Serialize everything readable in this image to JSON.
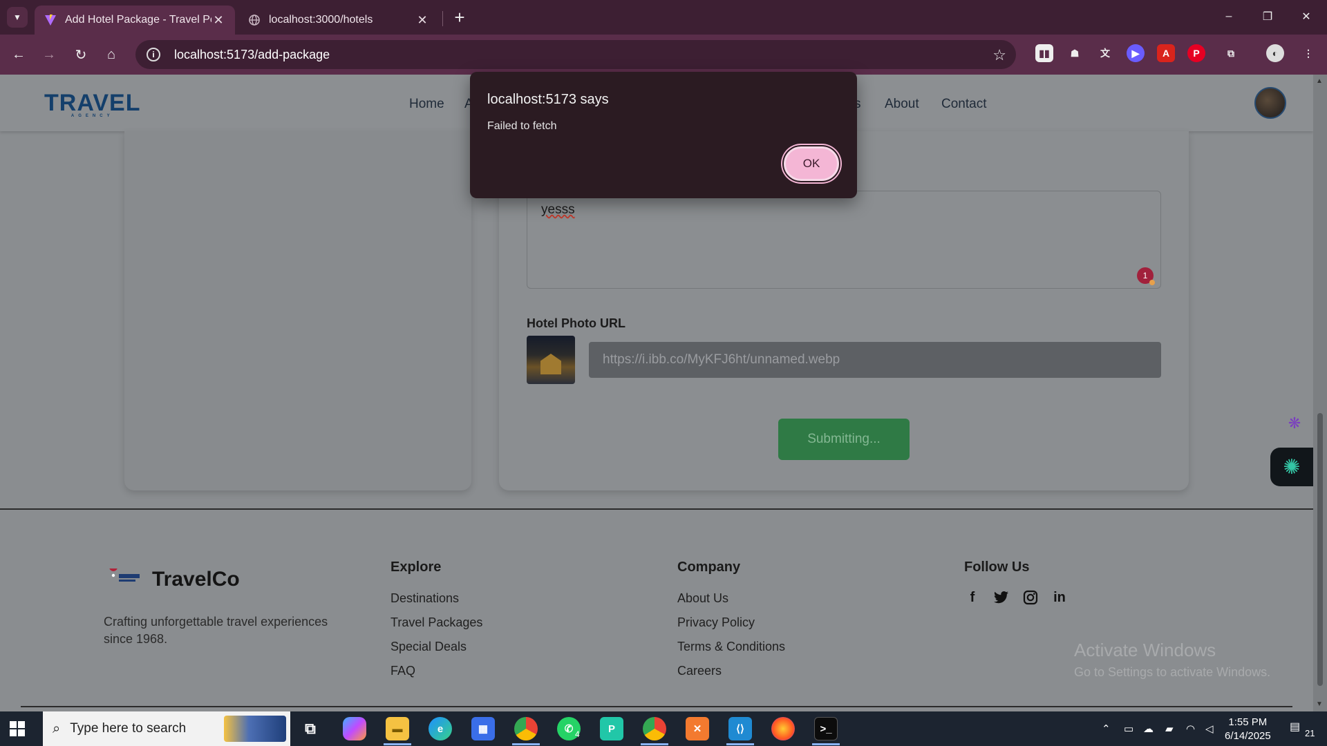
{
  "browser": {
    "tabs": [
      {
        "title": "Add Hotel Package - Travel Port",
        "active": true
      },
      {
        "title": "localhost:3000/hotels",
        "active": false
      }
    ],
    "url": "localhost:5173/add-package",
    "window_controls": {
      "minimize": "–",
      "restore": "❐",
      "close": "✕"
    }
  },
  "header": {
    "logo_main": "TRAVEL",
    "logo_sub": "AGENCY",
    "nav": [
      "Home",
      "A",
      "s",
      "About",
      "Contact"
    ]
  },
  "form": {
    "textarea_value": "yesss",
    "badge_count": "1",
    "photo_label": "Hotel Photo URL",
    "photo_placeholder": "https://i.ibb.co/MyKFJ6ht/unnamed.webp",
    "submit_label": "Submitting..."
  },
  "footer": {
    "brand": "TravelCo",
    "description": "Crafting unforgettable travel experiences since 1968.",
    "columns": [
      {
        "title": "Explore",
        "links": [
          "Destinations",
          "Travel Packages",
          "Special Deals",
          "FAQ"
        ]
      },
      {
        "title": "Company",
        "links": [
          "About Us",
          "Privacy Policy",
          "Terms & Conditions",
          "Careers"
        ]
      },
      {
        "title": "Follow Us",
        "links": []
      }
    ],
    "social_icons": [
      "facebook-icon",
      "twitter-icon",
      "instagram-icon",
      "linkedin-icon"
    ]
  },
  "watermark": {
    "line1": "Activate Windows",
    "line2": "Go to Settings to activate Windows."
  },
  "alert": {
    "title": "localhost:5173 says",
    "message": "Failed to fetch",
    "ok_label": "OK"
  },
  "taskbar": {
    "search_placeholder": "Type here to search",
    "time": "1:55 PM",
    "date": "6/14/2025",
    "notification_count": "21",
    "whatsapp_badge": "4"
  },
  "colors": {
    "tab_bar": "#3d1f33",
    "address_bar": "#5a2d4a",
    "submit_button": "#2f7a45",
    "alert_bg": "#2b1b22",
    "ok_button": "#f4b6d5"
  }
}
